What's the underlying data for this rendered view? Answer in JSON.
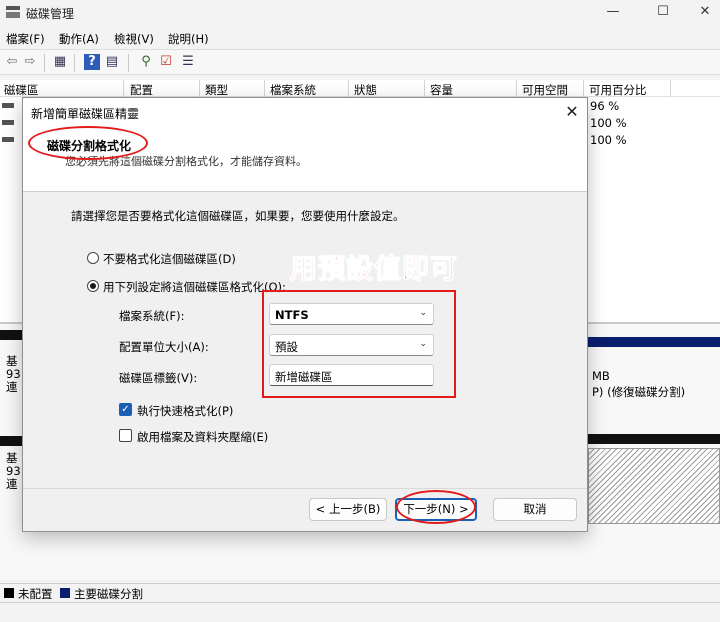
{
  "window": {
    "title": "磁碟管理",
    "minimize_glyph": "—",
    "maximize_glyph": "☐",
    "close_glyph": "✕"
  },
  "menu": [
    "檔案(F)",
    "動作(A)",
    "檢視(V)",
    "說明(H)"
  ],
  "toolbar": {
    "icons": [
      "back-arrow-icon",
      "forward-arrow-icon",
      "properties-icon",
      "help-icon",
      "console-tree-icon",
      "connect-icon",
      "check-icon",
      "list-icon"
    ],
    "glyphs": [
      "⇦",
      "⇨",
      "▦",
      "?",
      "▤",
      "⚲",
      "☑",
      "☰"
    ]
  },
  "volume_table": {
    "columns": [
      "磁碟區",
      "配置",
      "類型",
      "檔案系統",
      "狀態",
      "容量",
      "可用空間",
      "可用百分比"
    ],
    "rows": [
      {
        "free_pct": "96 %"
      },
      {
        "free_pct": "100 %"
      },
      {
        "free_pct": "100 %"
      }
    ]
  },
  "disks": [
    {
      "label_lines": [
        "基",
        "93",
        "連"
      ],
      "partition_size": "MB",
      "partition_status": "P) (修復磁碟分割)"
    },
    {
      "label_lines": [
        "基",
        "93",
        "連"
      ]
    }
  ],
  "legend": [
    {
      "label": "未配置",
      "color": "#000000"
    },
    {
      "label": "主要磁碟分割",
      "color": "#0a1e6e"
    }
  ],
  "dialog": {
    "title": "新增簡單磁碟區精靈",
    "close_glyph": "✕",
    "header_title": "磁碟分割格式化",
    "header_subtitle": "您必須先將這個磁碟分割格式化，才能儲存資料。",
    "prompt": "請選擇您是否要格式化這個磁碟區，如果要，您要使用什麼設定。",
    "option_no_format": "不要格式化這個磁碟區(D)",
    "option_format": "用下列設定將這個磁碟區格式化(O):",
    "filesystem_label": "檔案系統(F):",
    "filesystem_value": "NTFS",
    "allocation_label": "配置單位大小(A):",
    "allocation_value": "預設",
    "volume_label_label": "磁碟區標籤(V):",
    "volume_label_value": "新增磁碟區",
    "quick_format_label": "執行快速格式化(P)",
    "quick_format_checked": true,
    "compression_label": "啟用檔案及資料夾壓縮(E)",
    "compression_checked": false,
    "back_button": "< 上一步(B)",
    "next_button": "下一步(N) >",
    "cancel_button": "取消"
  },
  "annotation": {
    "text": "用預設值即可",
    "color": "#e21b1b"
  }
}
